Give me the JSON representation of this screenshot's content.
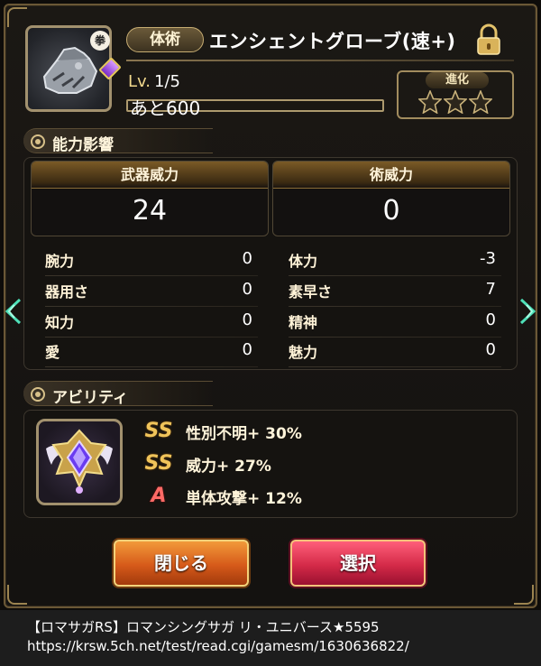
{
  "header": {
    "category": "体術",
    "item_name": "エンシェントグローブ(速+)",
    "type_mark": "拳",
    "level_label": "Lv.",
    "level_value": "1/5",
    "exp_text": "あと600",
    "exp_progress": 0.0,
    "evolution_label": "進化",
    "evolution_stars_filled": 0,
    "evolution_stars_total": 3,
    "icons": [
      "gauntlet-icon",
      "lock-icon",
      "star-icon"
    ]
  },
  "stats_section": {
    "title": "能力影響",
    "weapon_power": {
      "label": "武器威力",
      "value": "24"
    },
    "skill_power": {
      "label": "術威力",
      "value": "0"
    },
    "left": [
      {
        "label": "腕力",
        "value": "0"
      },
      {
        "label": "器用さ",
        "value": "0"
      },
      {
        "label": "知力",
        "value": "0"
      },
      {
        "label": "愛",
        "value": "0"
      }
    ],
    "right": [
      {
        "label": "体力",
        "value": "-3"
      },
      {
        "label": "素早さ",
        "value": "7"
      },
      {
        "label": "精神",
        "value": "0"
      },
      {
        "label": "魅力",
        "value": "0"
      }
    ]
  },
  "ability_section": {
    "title": "アビリティ",
    "abilities": [
      {
        "rank": "SS",
        "text": "性別不明+ 30%"
      },
      {
        "rank": "SS",
        "text": "威力+ 27%"
      },
      {
        "rank": "A",
        "text": "単体攻撃+ 12%"
      }
    ]
  },
  "buttons": {
    "close": "閉じる",
    "select": "選択"
  },
  "footer": {
    "line1": "【ロマサガRS】ロマンシングサガ リ・ユニバース★5595",
    "line2": "https://krsw.5ch.net/test/read.cgi/gamesm/1630636822/"
  },
  "colors": {
    "gold": "#d7c089",
    "close_button": "#d65a1a",
    "select_button": "#d42a48",
    "rank_ss": "#f0c45a",
    "rank_a": "#ff6a66"
  }
}
